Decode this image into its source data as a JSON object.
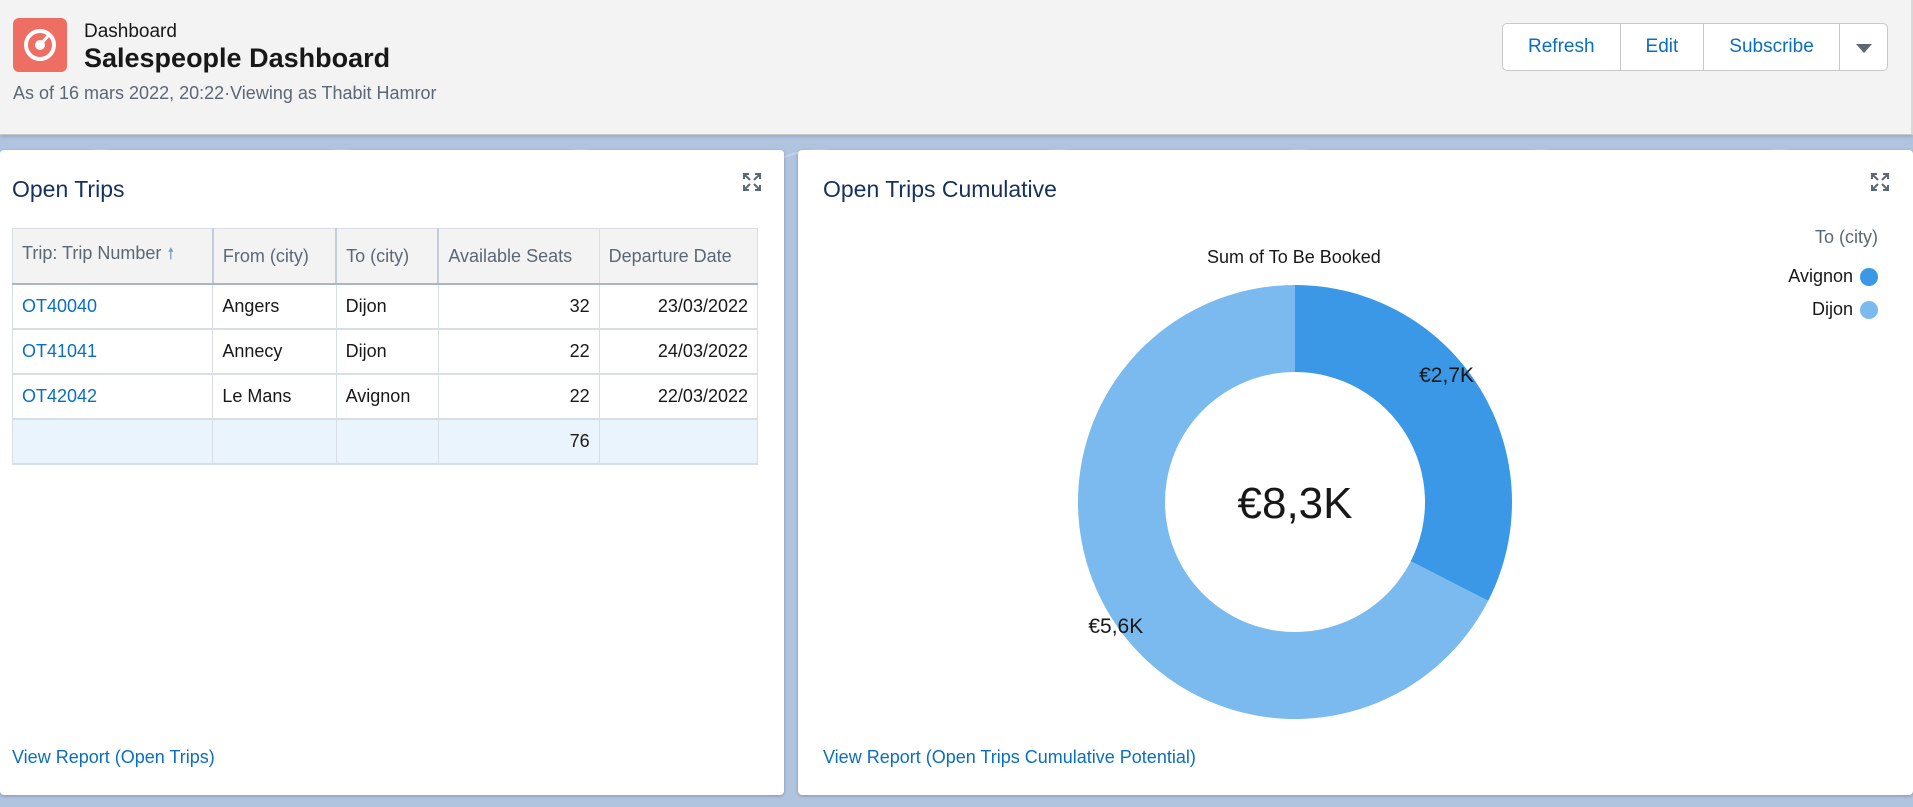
{
  "header": {
    "object_label": "Dashboard",
    "title": "Salespeople Dashboard",
    "subtitle": "As of 16 mars 2022, 20:22·Viewing as Thabit Hamror",
    "buttons": {
      "refresh": "Refresh",
      "edit": "Edit",
      "subscribe": "Subscribe"
    },
    "icon": "dashboard-gauge-icon",
    "icon_color": "#ef6e64"
  },
  "open_trips": {
    "title": "Open Trips",
    "columns": [
      "Trip: Trip Number",
      "From (city)",
      "To (city)",
      "Available Seats",
      "Departure Date"
    ],
    "rows": [
      [
        "OT40040",
        "Angers",
        "Dijon",
        "32",
        "23/03/2022"
      ],
      [
        "OT41041",
        "Annecy",
        "Dijon",
        "22",
        "24/03/2022"
      ],
      [
        "OT42042",
        "Le Mans",
        "Avignon",
        "22",
        "22/03/2022"
      ]
    ],
    "total_seats": "76",
    "view_report": "View Report (Open Trips)"
  },
  "cumulative": {
    "title": "Open Trips Cumulative",
    "view_report": "View Report (Open Trips Cumulative Potential)"
  },
  "chart_data": {
    "type": "pie",
    "title": "Sum of To Be Booked",
    "center_label": "€8,3K",
    "legend_title": "To (city)",
    "legend_position": "top-right",
    "categories": [
      "Avignon",
      "Dijon"
    ],
    "values": [
      2.7,
      5.6
    ],
    "value_labels": [
      "€2,7K",
      "€5,6K"
    ],
    "colors": [
      "#3a98e6",
      "#7bbaee"
    ]
  }
}
